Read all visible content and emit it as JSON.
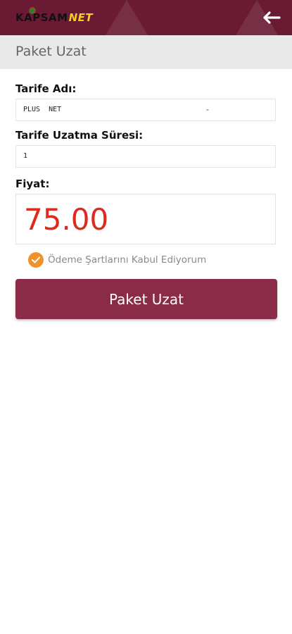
{
  "header": {
    "logo_main": "KAPSAM",
    "logo_net": "NET",
    "back_icon": "arrow-left-icon"
  },
  "page_title": "Paket Uzat",
  "form": {
    "tariff_label": "Tarife Adı:",
    "tariff_value": "PLUS  NET",
    "tariff_suffix": "-",
    "duration_label": "Tarife Uzatma Süresi:",
    "duration_value": "1",
    "price_label": "Fiyat:",
    "price_value": "75.00",
    "terms_label": "Ödeme Şartlarını Kabul Ediyorum",
    "terms_checked": true,
    "submit_label": "Paket Uzat"
  },
  "colors": {
    "header_bg": "#6a1b33",
    "button_bg": "#8a2b47",
    "price_color": "#e0281b",
    "check_color": "#f0912a"
  }
}
